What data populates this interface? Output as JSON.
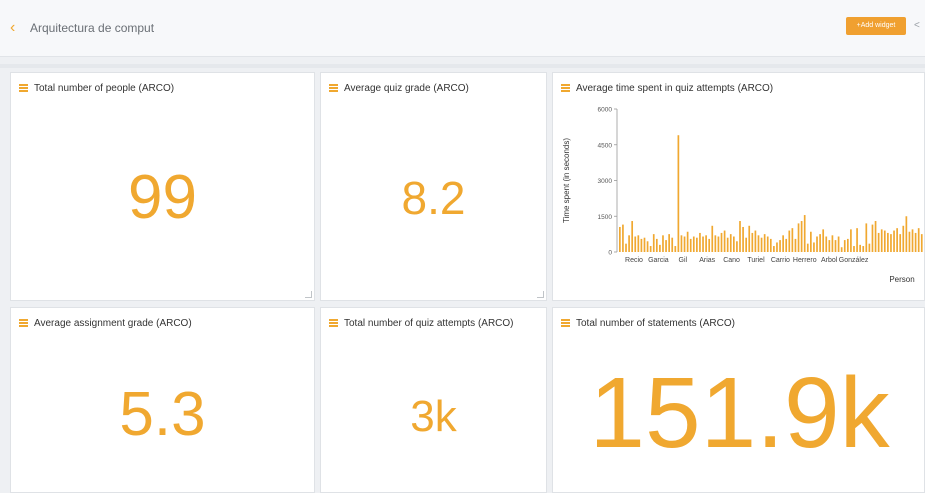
{
  "header": {
    "back_icon": "chevron-left-icon",
    "title": "Arquitectura de comput",
    "add_widget_label": "+Add widget",
    "share_icon": "share-icon"
  },
  "cards": {
    "people": {
      "title": "Total number of people (ARCO)",
      "value": "99"
    },
    "quiz_grade": {
      "title": "Average quiz grade (ARCO)",
      "value": "8.2"
    },
    "time_spent": {
      "title": "Average time spent in quiz attempts (ARCO)"
    },
    "assignment_grade": {
      "title": "Average assignment grade (ARCO)",
      "value": "5.3"
    },
    "quiz_attempts": {
      "title": "Total number of quiz attempts (ARCO)",
      "value": "3k"
    },
    "statements": {
      "title": "Total number of statements (ARCO)",
      "value": "151.9k"
    }
  },
  "colors": {
    "accent": "#f0a830",
    "button": "#f0a030"
  },
  "chart_data": {
    "type": "bar",
    "ylabel": "Time spent (in seconds)",
    "xlabel": "Person",
    "ylim": [
      0,
      6000
    ],
    "yticks": [
      0,
      1500,
      3000,
      4500,
      6000
    ],
    "x_tick_labels": [
      "Recio",
      "Garcia",
      "Gil",
      "Arias",
      "Cano",
      "Turiel",
      "Carrio",
      "Herrero",
      "Arbol",
      "González"
    ],
    "values": [
      1050,
      1150,
      350,
      700,
      1300,
      650,
      700,
      550,
      600,
      450,
      250,
      750,
      550,
      300,
      700,
      500,
      750,
      600,
      250,
      4900,
      700,
      650,
      850,
      550,
      650,
      600,
      800,
      650,
      700,
      550,
      1100,
      700,
      650,
      800,
      900,
      600,
      750,
      650,
      450,
      1300,
      1050,
      600,
      1100,
      800,
      900,
      700,
      600,
      750,
      650,
      550,
      250,
      400,
      500,
      700,
      550,
      900,
      1000,
      550,
      1200,
      1300,
      1550,
      350,
      850,
      400,
      650,
      750,
      950,
      650,
      500,
      700,
      500,
      650,
      200,
      500,
      550,
      950,
      250,
      1000,
      300,
      250,
      1200,
      350,
      1150,
      1300,
      800,
      950,
      900,
      800,
      750,
      900,
      1000,
      750,
      1100,
      1500,
      850,
      950,
      800,
      1000,
      750
    ]
  }
}
